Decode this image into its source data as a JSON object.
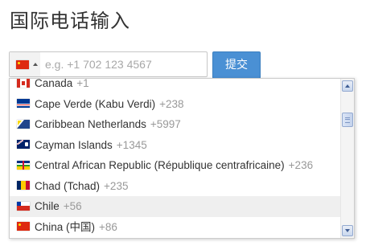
{
  "page": {
    "title": "国际电话输入"
  },
  "phone_input": {
    "placeholder": "e.g. +1 702 123 4567",
    "value": "",
    "selected_flag": "cn-flag-icon"
  },
  "submit": {
    "label": "提交"
  },
  "dropdown": {
    "countries": [
      {
        "name": "Canada",
        "dial_code": "+1",
        "flag": "ca-flag-icon"
      },
      {
        "name": "Cape Verde (Kabu Verdi)",
        "dial_code": "+238",
        "flag": "cv-flag-icon"
      },
      {
        "name": "Caribbean Netherlands",
        "dial_code": "+5997",
        "flag": "bq-flag-icon"
      },
      {
        "name": "Cayman Islands",
        "dial_code": "+1345",
        "flag": "ky-flag-icon"
      },
      {
        "name": "Central African Republic (République centrafricaine)",
        "dial_code": "+236",
        "flag": "cf-flag-icon"
      },
      {
        "name": "Chad (Tchad)",
        "dial_code": "+235",
        "flag": "td-flag-icon"
      },
      {
        "name": "Chile",
        "dial_code": "+56",
        "flag": "cl-flag-icon",
        "highlighted": true
      },
      {
        "name": "China (中国)",
        "dial_code": "+86",
        "flag": "cn-flag-icon"
      }
    ]
  },
  "colors": {
    "button": "#4a90d4",
    "highlight_row": "#efefef",
    "dial_code_text": "#999999"
  }
}
